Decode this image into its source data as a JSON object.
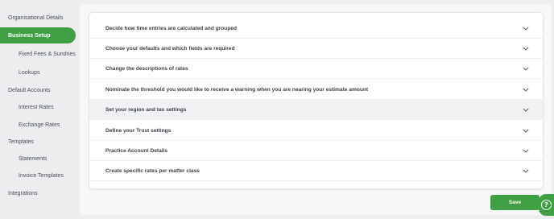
{
  "sidebar": {
    "items": [
      {
        "label": "Organisational Details",
        "active": false,
        "level": 1
      },
      {
        "label": "Business Setup",
        "active": true,
        "level": 1
      },
      {
        "label": "Fixed Fees & Sundries",
        "active": false,
        "level": 2
      },
      {
        "label": "Lookups",
        "active": false,
        "level": 2
      },
      {
        "label": "Default Accounts",
        "active": false,
        "level": 1
      },
      {
        "label": "Interest Rates",
        "active": false,
        "level": 2
      },
      {
        "label": "Exchange Rates",
        "active": false,
        "level": 2
      },
      {
        "label": "Templates",
        "active": false,
        "level": 1
      },
      {
        "label": "Statements",
        "active": false,
        "level": 2
      },
      {
        "label": "Invoice Templates",
        "active": false,
        "level": 2
      },
      {
        "label": "Integrations",
        "active": false,
        "level": 1
      }
    ]
  },
  "sections": [
    {
      "label": "Decide how time entries are calculated and grouped",
      "icon": "chevron-down-icon"
    },
    {
      "label": "Choose your defaults and which fields are required",
      "icon": "chevron-down-icon"
    },
    {
      "label": "Change the descriptions of rates",
      "icon": "chevron-down-icon"
    },
    {
      "label": "Nominate the threshold you would like to receive a warning when you are nearing your estimate amount",
      "icon": "chevron-down-icon"
    },
    {
      "label": "Set your region and tax settings",
      "icon": "chevron-down-icon",
      "highlighted": true
    },
    {
      "label": "Define your Trust settings",
      "icon": "chevron-down-icon"
    },
    {
      "label": "Practice Account Details",
      "icon": "chevron-down-icon"
    },
    {
      "label": "Create specific rates per matter class",
      "icon": "chevron-down-icon"
    }
  ],
  "actions": {
    "save_label": "Save",
    "help_icon": "help-icon",
    "help_glyph": "?"
  },
  "colors": {
    "accent": "#3e9f43",
    "background": "#ecedef",
    "text": "#3b4048"
  }
}
